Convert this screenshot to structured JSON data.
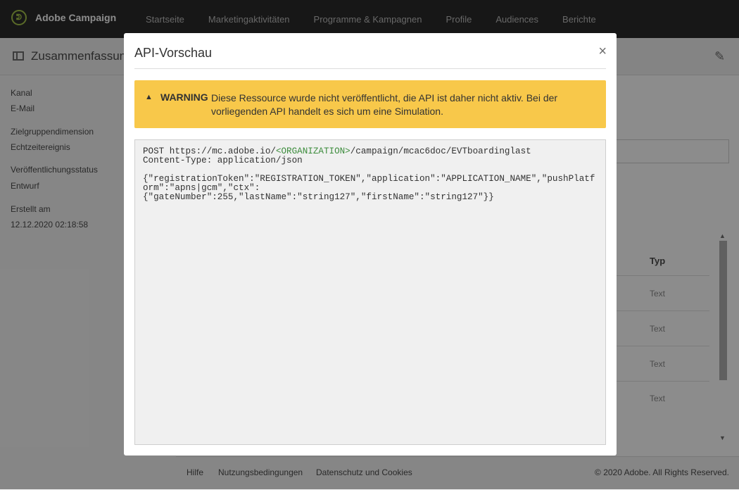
{
  "app": {
    "name": "Adobe Campaign"
  },
  "nav": [
    "Startseite",
    "Marketingaktivitäten",
    "Programme & Kampagnen",
    "Profile",
    "Audiences",
    "Berichte"
  ],
  "page": {
    "title": "Zusammenfassung"
  },
  "summary": {
    "fields": [
      {
        "label": "Kanal",
        "value": "E-Mail"
      },
      {
        "label": "Zielgruppendimension",
        "value": "Echtzeitereignis"
      },
      {
        "label": "Veröffentlichungsstatus",
        "value": "Entwurf"
      },
      {
        "label": "Erstellt am",
        "value": "12.12.2020 02:18:58"
      }
    ]
  },
  "table": {
    "header": "Typ",
    "rows": [
      "Text",
      "Text",
      "Text",
      "Text"
    ]
  },
  "footer": {
    "links": [
      "Hilfe",
      "Nutzungsbedingungen",
      "Datenschutz und Cookies"
    ],
    "copyright": "© 2020 Adobe. All Rights Reserved."
  },
  "modal": {
    "title": "API-Vorschau",
    "close": "×",
    "warning": {
      "label": "WARNING",
      "text": "Diese Ressource wurde nicht veröffentlicht, die API ist daher nicht aktiv. Bei der vorliegenden API handelt es sich um eine Simulation."
    },
    "code": {
      "line1_prefix": "POST https://mc.adobe.io/",
      "org": "<ORGANIZATION>",
      "line1_suffix": "/campaign/mcac6doc/EVTboardinglast",
      "line2": "Content-Type: application/json",
      "body": "{\"registrationToken\":\"REGISTRATION_TOKEN\",\"application\":\"APPLICATION_NAME\",\"pushPlatform\":\"apns|gcm\",\"ctx\":\n{\"gateNumber\":255,\"lastName\":\"string127\",\"firstName\":\"string127\"}}"
    }
  },
  "colors": {
    "warning": "#f8c84a",
    "brand_accent": "#a5c44a",
    "topbar": "#2b2b2b",
    "code_org": "#3c8c3c"
  }
}
